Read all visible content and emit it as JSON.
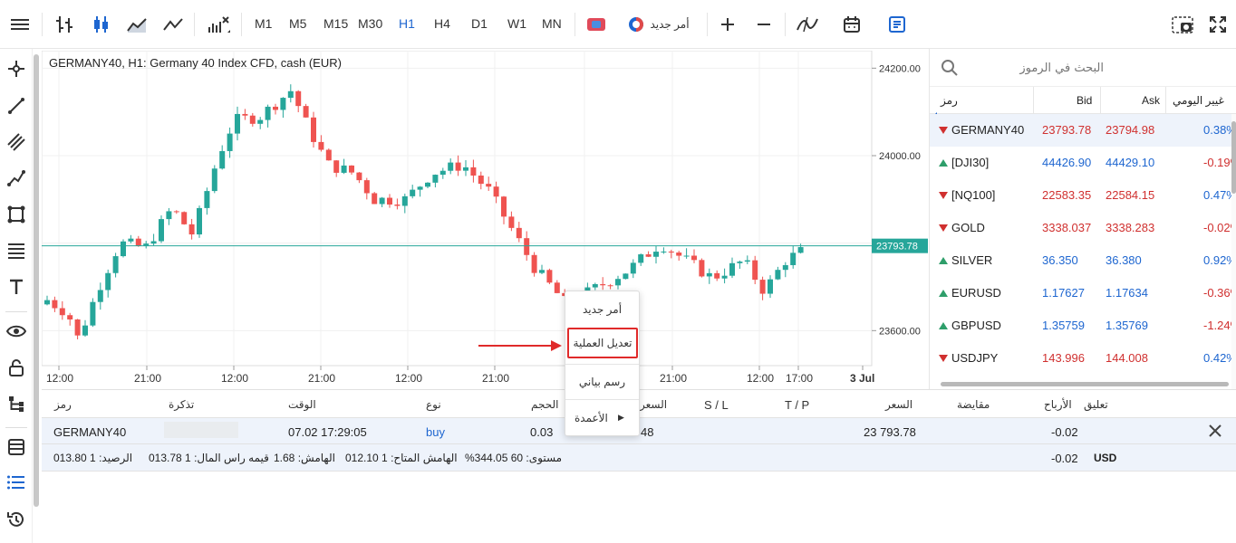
{
  "toolbar": {
    "timeframes": [
      "M1",
      "M5",
      "M15",
      "M30",
      "H1",
      "H4",
      "D1",
      "W1",
      "MN"
    ],
    "active_timeframe": "H1",
    "new_order_label": "أمر جديد"
  },
  "chart": {
    "title": "GERMANY40, H1: Germany 40 Index CFD, cash (EUR)",
    "price_labels": [
      "24200.00",
      "24000.00",
      "23600.00"
    ],
    "current_price": "23793.78",
    "time_labels": [
      "12:00",
      "21:00",
      "12:00",
      "21:00",
      "12:00",
      "21:00",
      "21:00",
      "12:00",
      "17:00",
      "3 Jul"
    ],
    "colors": {
      "up": "#26a69a",
      "down": "#ef5350",
      "price_line": "#26a69a"
    }
  },
  "chart_data": {
    "type": "candlestick",
    "symbol": "GERMANY40",
    "timeframe": "H1",
    "price_range": [
      23520,
      24240
    ],
    "current_price": 23793.78
  },
  "market_watch": {
    "search_placeholder": "البحث في الرموز",
    "headers": {
      "symbol": "رمز",
      "bid": "Bid",
      "ask": "Ask",
      "change": "غيير اليومي"
    },
    "rows": [
      {
        "symbol": "GERMANY40",
        "bid": "23793.78",
        "ask": "23794.98",
        "change": "0.38%",
        "dir": "down"
      },
      {
        "symbol": "[DJI30]",
        "bid": "44426.90",
        "ask": "44429.10",
        "change": "-0.19%",
        "dir": "up"
      },
      {
        "symbol": "[NQ100]",
        "bid": "22583.35",
        "ask": "22584.15",
        "change": "0.47%",
        "dir": "down"
      },
      {
        "symbol": "GOLD",
        "bid": "3338.037",
        "ask": "3338.283",
        "change": "-0.02%",
        "dir": "down"
      },
      {
        "symbol": "SILVER",
        "bid": "36.350",
        "ask": "36.380",
        "change": "0.92%",
        "dir": "up"
      },
      {
        "symbol": "EURUSD",
        "bid": "1.17627",
        "ask": "1.17634",
        "change": "-0.36%",
        "dir": "up"
      },
      {
        "symbol": "GBPUSD",
        "bid": "1.35759",
        "ask": "1.35769",
        "change": "-1.24%",
        "dir": "up"
      },
      {
        "symbol": "USDJPY",
        "bid": "143.996",
        "ask": "144.008",
        "change": "0.42%",
        "dir": "down"
      }
    ]
  },
  "positions": {
    "headers": {
      "symbol": "رمز",
      "ticket": "تذكرة",
      "time": "الوقت",
      "type": "نوع",
      "volume": "الحجم",
      "price_open": "السعر",
      "sl": "S / L",
      "tp": "T / P",
      "price": "السعر",
      "swap": "مقايضة",
      "profit": "الأرباح",
      "comment": "تعليق"
    },
    "row": {
      "symbol": "GERMANY40",
      "time": "07.02 17:29:05",
      "type": "buy",
      "volume": "0.03",
      "open_price_partial": "48",
      "price": "23 793.78",
      "profit": "-0.02"
    },
    "summary": {
      "level": "%مستوى: 60 344.05",
      "free_margin": "الهامش المتاح: 1 012.10",
      "margin": "الهامش: 1.68",
      "equity": "قيمه راس المال: 1 013.78",
      "balance": "الرصيد: 1 013.80",
      "profit": "-0.02",
      "currency": "USD"
    }
  },
  "context_menu": {
    "items": [
      "أمر جديد",
      "تعديل العملية",
      "رسم بياني",
      "الأعمدة"
    ],
    "highlighted": "تعديل العملية"
  }
}
